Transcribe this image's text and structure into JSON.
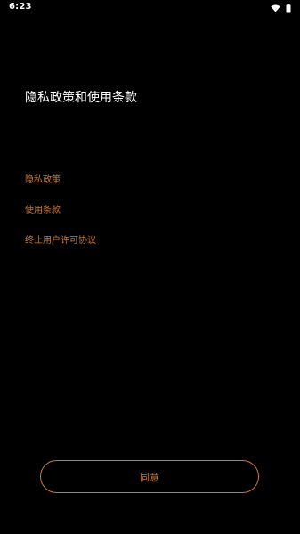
{
  "status_bar": {
    "time": "6:23",
    "icons": [
      "wifi-icon",
      "battery-icon"
    ]
  },
  "page": {
    "title": "隐私政策和使用条款"
  },
  "links": [
    {
      "label": "隐私政策"
    },
    {
      "label": "使用条款"
    },
    {
      "label": "终止用户许可协议"
    }
  ],
  "actions": {
    "agree_label": "同意"
  },
  "colors": {
    "background": "#000000",
    "accent": "#c97a3e",
    "text_primary": "#ffffff"
  }
}
